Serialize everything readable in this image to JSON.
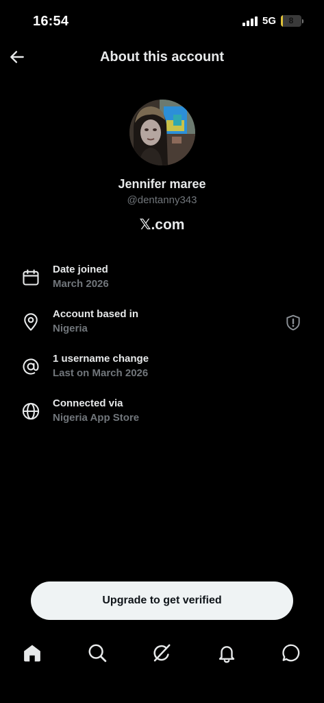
{
  "status_bar": {
    "time": "16:54",
    "network": "5G",
    "battery_percent": "8",
    "battery_level": 0.08
  },
  "header": {
    "title": "About this account",
    "back_icon": "arrow-left-icon"
  },
  "profile": {
    "name": "Jennifer maree",
    "handle": "@dentanny343",
    "site_suffix": ".com",
    "site_mark": "𝕏"
  },
  "info": [
    {
      "icon": "calendar-icon",
      "title": "Date joined",
      "sub": "March 2026"
    },
    {
      "icon": "location-pin-icon",
      "title": "Account based in",
      "sub": "Nigeria",
      "action_icon": "shield-alert-icon"
    },
    {
      "icon": "at-sign-icon",
      "title": "1 username change",
      "sub": "Last on March 2026"
    },
    {
      "icon": "globe-icon",
      "title": "Connected via",
      "sub": "Nigeria App Store"
    }
  ],
  "cta": {
    "label": "Upgrade to get verified"
  },
  "nav": [
    "home-icon",
    "search-icon",
    "grok-icon",
    "notifications-bell-icon",
    "messages-icon"
  ],
  "colors": {
    "background": "#000000",
    "primary_text": "#e7e9ea",
    "secondary_text": "#71767b",
    "button_bg": "#eff3f4",
    "button_text": "#0f1419",
    "battery": "#e0c239"
  }
}
